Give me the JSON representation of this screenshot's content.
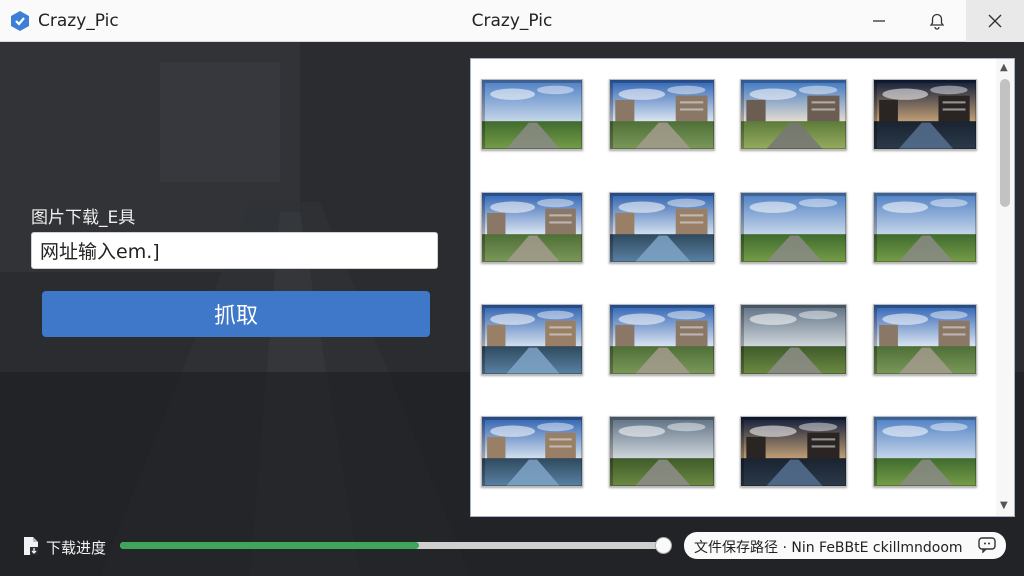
{
  "window": {
    "app_name": "Crazy_Pic",
    "title": "Crazy_Pic",
    "controls": [
      "minimize-icon",
      "bell-icon",
      "close-icon"
    ]
  },
  "form": {
    "tool_label": "图片下载_E具",
    "url_value": "网址输入em.]",
    "fetch_label": "抓取"
  },
  "gallery": {
    "thumbnails": [
      {
        "scene": "field-road"
      },
      {
        "scene": "buildings-path"
      },
      {
        "scene": "road-field"
      },
      {
        "scene": "dusk-canal"
      },
      {
        "scene": "buildings-path"
      },
      {
        "scene": "canal-buildings"
      },
      {
        "scene": "field-road"
      },
      {
        "scene": "field-road"
      },
      {
        "scene": "canal-buildings"
      },
      {
        "scene": "buildings-path"
      },
      {
        "scene": "cloudy-field"
      },
      {
        "scene": "buildings-path"
      },
      {
        "scene": "canal-buildings"
      },
      {
        "scene": "cloudy-field"
      },
      {
        "scene": "dusk-canal"
      },
      {
        "scene": "field-road"
      }
    ]
  },
  "footer": {
    "download_label": "下载进度",
    "progress": 0.58,
    "save_path": "文件保存路径 · Nin FeBBtE ckillmndoom"
  },
  "colors": {
    "accent": "#3f78c8",
    "progress": "#3ea55a",
    "background": "#26282c"
  }
}
